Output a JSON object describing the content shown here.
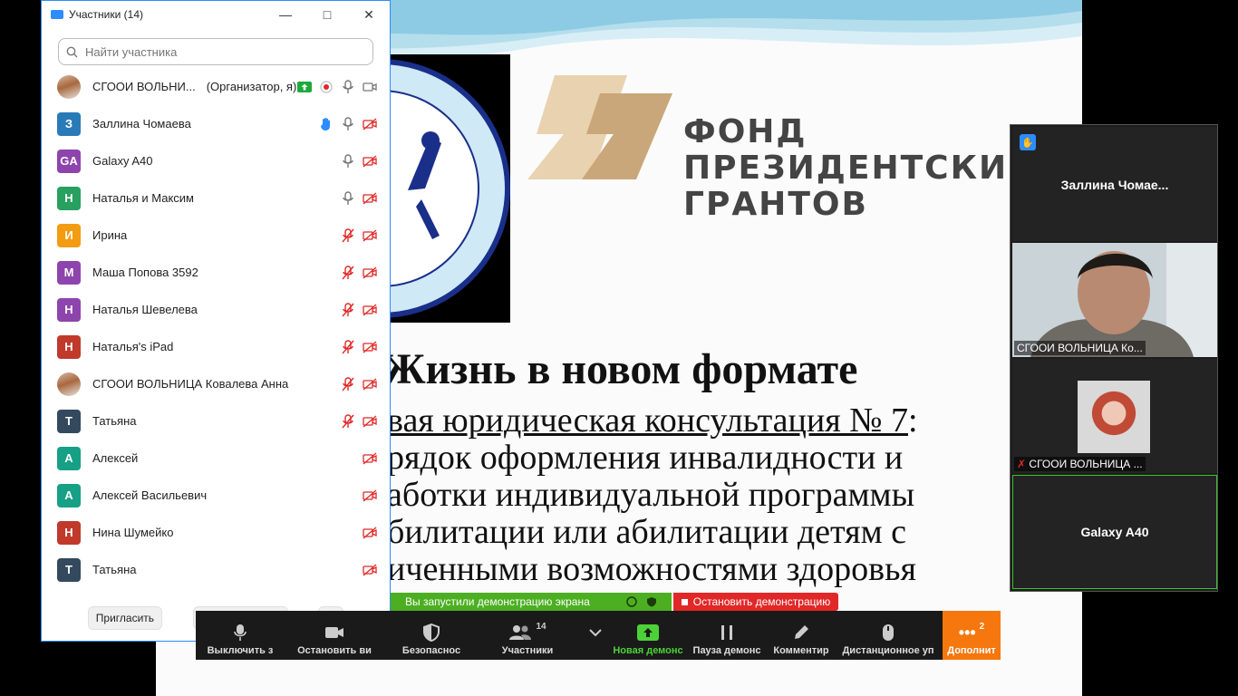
{
  "participants_window": {
    "title": "Участники (14)",
    "search_placeholder": "Найти участника",
    "participants": [
      {
        "avatar_text": "",
        "avatar_color": "photo",
        "name": "СГООИ ВОЛЬНИ...",
        "role": "(Организатор, я)",
        "icons": [
          "share-badge-icon",
          "record-icon",
          "mic-on-icon",
          "video-on-icon"
        ]
      },
      {
        "avatar_text": "З",
        "avatar_color": "#2a7ab8",
        "name": "Заллина Чомаева",
        "role": "",
        "icons": [
          "raised-hand-icon",
          "mic-on-icon",
          "video-off-icon"
        ]
      },
      {
        "avatar_text": "GA",
        "avatar_color": "#8e44ad",
        "name": "Galaxy A40",
        "role": "",
        "icons": [
          "mic-on-icon",
          "video-off-icon"
        ]
      },
      {
        "avatar_text": "Н",
        "avatar_color": "#27a060",
        "name": "Наталья и Максим",
        "role": "",
        "icons": [
          "mic-on-icon",
          "video-off-icon"
        ]
      },
      {
        "avatar_text": "И",
        "avatar_color": "#f39c12",
        "name": "Ирина",
        "role": "",
        "icons": [
          "mic-off-icon",
          "video-off-icon"
        ]
      },
      {
        "avatar_text": "М",
        "avatar_color": "#8e44ad",
        "name": "Маша Попова 3592",
        "role": "",
        "icons": [
          "mic-off-icon",
          "video-off-icon"
        ]
      },
      {
        "avatar_text": "Н",
        "avatar_color": "#8e44ad",
        "name": "Наталья Шевелева",
        "role": "",
        "icons": [
          "mic-off-icon",
          "video-off-icon"
        ]
      },
      {
        "avatar_text": "Н",
        "avatar_color": "#c0392b",
        "name": "Наталья's iPad",
        "role": "",
        "icons": [
          "mic-off-icon",
          "video-off-icon"
        ]
      },
      {
        "avatar_text": "",
        "avatar_color": "photo",
        "name": "СГООИ ВОЛЬНИЦА Ковалева Анна",
        "role": "",
        "icons": [
          "mic-off-icon",
          "video-off-icon"
        ]
      },
      {
        "avatar_text": "Т",
        "avatar_color": "#34495e",
        "name": "Татьяна",
        "role": "",
        "icons": [
          "mic-off-icon",
          "video-off-icon"
        ]
      },
      {
        "avatar_text": "А",
        "avatar_color": "#16a085",
        "name": "Алексей",
        "role": "",
        "icons": [
          "video-off-icon"
        ]
      },
      {
        "avatar_text": "А",
        "avatar_color": "#16a085",
        "name": "Алексей Васильевич",
        "role": "",
        "icons": [
          "video-off-icon"
        ]
      },
      {
        "avatar_text": "Н",
        "avatar_color": "#c0392b",
        "name": "Нина Шумейко",
        "role": "",
        "icons": [
          "video-off-icon"
        ]
      },
      {
        "avatar_text": "Т",
        "avatar_color": "#34495e",
        "name": "Татьяна",
        "role": "",
        "icons": [
          "video-off-icon"
        ]
      }
    ],
    "footer": {
      "invite": "Пригласить",
      "mute_all": "Выкл. весь звук",
      "more": "..."
    }
  },
  "slide": {
    "fund_lines": [
      "ФОНД",
      "ПРЕЗИДЕНТСКИ",
      "ГРАНТОВ"
    ],
    "title": "Жизнь в новом формате",
    "subtitle_underlined": "вая юридическая консультация № 7",
    "subtitle_colon": ":",
    "subtitle_lines": [
      "рядок оформления инвалидности и",
      "аботки индивидуальной программы",
      "билитации или абилитации детям с",
      "иченными возможностями здоровья"
    ]
  },
  "video_panel": {
    "tile1_name": "Заллина  Чомае...",
    "tile2_label": "СГООИ ВОЛЬНИЦА Ко...",
    "tile3_label": "СГООИ ВОЛЬНИЦА ...",
    "tile4_name": "Galaxy A40"
  },
  "share_status": {
    "message": "Вы запустили демонстрацию экрана",
    "stop_label": "Остановить демонстрацию"
  },
  "toolbar": {
    "mute": "Выключить з",
    "stop_video": "Остановить ви",
    "security": "Безопаснос",
    "participants": "Участники",
    "participants_count": "14",
    "new_share": "Новая демонс",
    "pause_share": "Пауза демонс",
    "annotate": "Комментир",
    "remote_control": "Дистанционное уп",
    "more": "Дополнит",
    "more_badge": "2"
  },
  "colors": {
    "accent": "#2d8cff",
    "share_green": "#4caf22",
    "stop_red": "#e02828",
    "more_orange": "#f5770d",
    "muted_red": "#e02828"
  }
}
